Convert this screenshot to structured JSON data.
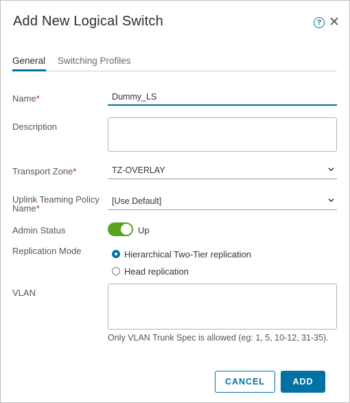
{
  "dialog": {
    "title": "Add New Logical Switch",
    "help_icon": "question-circle",
    "close_icon": "close"
  },
  "tabs": [
    {
      "label": "General",
      "active": true
    },
    {
      "label": "Switching Profiles",
      "active": false
    }
  ],
  "form": {
    "name": {
      "label": "Name",
      "required": "*",
      "value": "Dummy_LS"
    },
    "description": {
      "label": "Description",
      "value": ""
    },
    "transport_zone": {
      "label": "Transport Zone",
      "required": "*",
      "value": "TZ-OVERLAY"
    },
    "uplink_teaming": {
      "label_line1": "Uplink Teaming Policy",
      "label_line2": "Name",
      "required": "*",
      "value": "[Use Default]"
    },
    "admin_status": {
      "label": "Admin Status",
      "value": "Up",
      "on": true
    },
    "replication_mode": {
      "label": "Replication Mode",
      "options": [
        {
          "label": "Hierarchical Two-Tier replication",
          "selected": true
        },
        {
          "label": "Head replication",
          "selected": false
        }
      ]
    },
    "vlan": {
      "label": "VLAN",
      "value": "",
      "helper": "Only VLAN Trunk Spec is allowed (eg: 1, 5, 10-12, 31-35)."
    }
  },
  "buttons": {
    "cancel": "CANCEL",
    "add": "ADD"
  },
  "colors": {
    "accent": "#0072a3",
    "required": "#c92100",
    "toggle_on": "#5aa220"
  }
}
